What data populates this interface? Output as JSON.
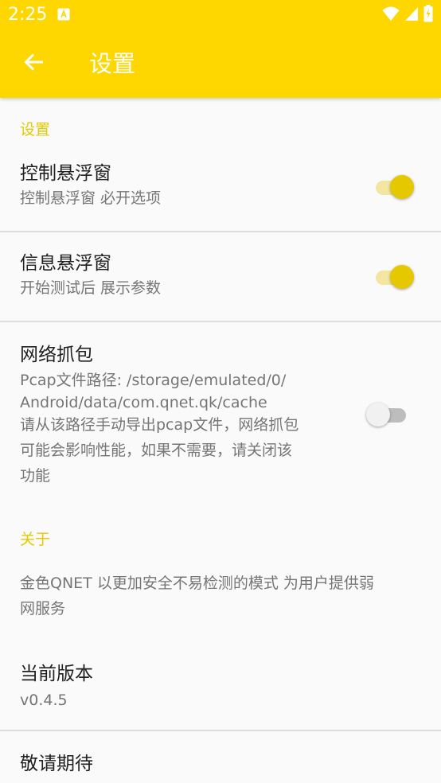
{
  "status_bar": {
    "time": "2:25",
    "notification_icon": "app-notification-icon",
    "icons": [
      "wifi-icon",
      "cell-signal-icon",
      "battery-charging-icon"
    ]
  },
  "app_bar": {
    "title": "设置",
    "back_icon": "arrow-back-icon",
    "color": "#fed700"
  },
  "colors": {
    "accent": "#e6c800",
    "title_text": "#202020",
    "summary_text": "#757575"
  },
  "settings_category": {
    "label": "设置"
  },
  "prefs": [
    {
      "title": "控制悬浮窗",
      "summary": "控制悬浮窗 必开选项",
      "enabled": true
    },
    {
      "title": "信息悬浮窗",
      "summary": "开始测试后 展示参数",
      "enabled": true
    },
    {
      "title": "网络抓包",
      "summary_lines": [
        "Pcap文件路径: /storage/emulated/0/",
        "Android/data/com.qnet.qk/cache",
        "请从该路径手动导出pcap文件，网络抓包",
        "可能会影响性能，如果不需要，请关闭该",
        "功能"
      ],
      "enabled": false
    }
  ],
  "about_category": {
    "label": "关于"
  },
  "about": {
    "description_lines": [
      "金色QNET 以更加安全不易检测的模式 为用户提供弱",
      "网服务"
    ],
    "version_title": "当前版本",
    "version_value": "v0.4.5",
    "coming_soon_title": "敬请期待"
  }
}
